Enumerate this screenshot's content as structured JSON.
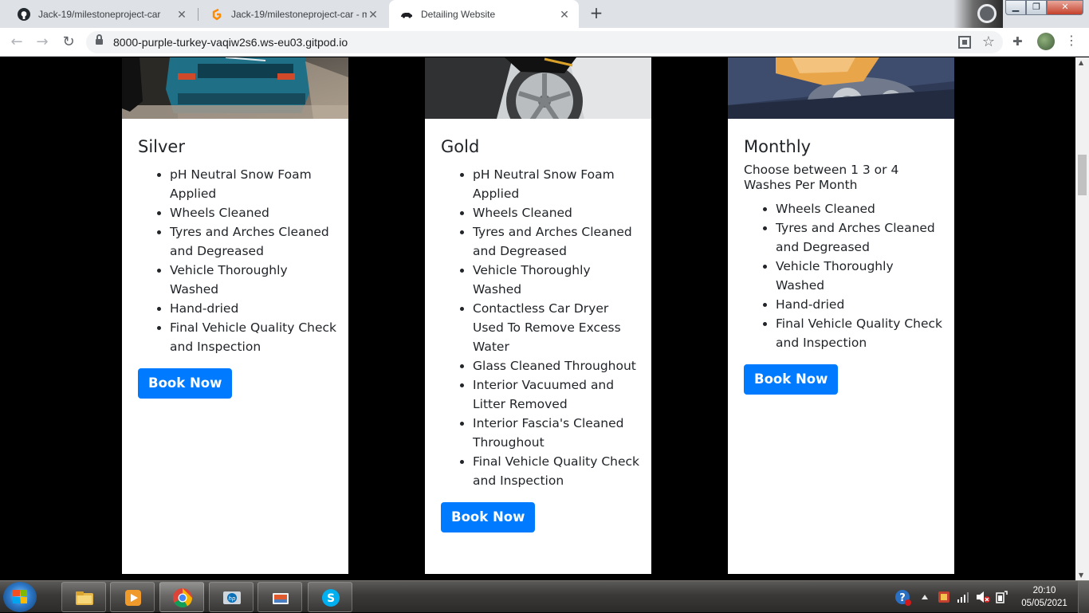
{
  "browser": {
    "tabs": [
      {
        "title": "Jack-19/milestoneproject-car",
        "icon": "github-icon",
        "active": false
      },
      {
        "title": "Jack-19/milestoneproject-car - m",
        "icon": "gitpod-icon",
        "active": false
      },
      {
        "title": "Detailing Website",
        "icon": "car-icon",
        "active": true
      }
    ],
    "url": "8000-purple-turkey-vaqiw2s6.ws-eu03.gitpod.io"
  },
  "packages": [
    {
      "name": "Silver",
      "features": [
        "pH Neutral Snow Foam Applied",
        "Wheels Cleaned",
        "Tyres and Arches Cleaned and Degreased",
        "Vehicle Thoroughly Washed",
        "Hand-dried",
        "Final Vehicle Quality Check and Inspection"
      ],
      "button": "Book Now"
    },
    {
      "name": "Gold",
      "features": [
        "pH Neutral Snow Foam Applied",
        "Wheels Cleaned",
        "Tyres and Arches Cleaned and Degreased",
        "Vehicle Thoroughly Washed",
        "Contactless Car Dryer Used To Remove Excess Water",
        "Glass Cleaned Throughout",
        "Interior Vacuumed and Litter Removed",
        "Interior Fascia's Cleaned Throughout",
        "Final Vehicle Quality Check and Inspection"
      ],
      "button": "Book Now"
    },
    {
      "name": "Monthly",
      "subtitle": "Choose between 1 3 or 4 Washes Per Month",
      "features": [
        "Wheels Cleaned",
        "Tyres and Arches Cleaned and Degreased",
        "Vehicle Thoroughly Washed",
        "Hand-dried",
        "Final Vehicle Quality Check and Inspection"
      ],
      "button": "Book Now"
    }
  ],
  "taskbar": {
    "apps": [
      "file-explorer-icon",
      "media-player-icon",
      "chrome-icon",
      "hp-icon",
      "paint-icon",
      "skype-icon"
    ],
    "time": "20:10",
    "date": "05/05/2021"
  },
  "colors": {
    "accent": "#007bff",
    "page_bg": "#000000",
    "card_bg": "#ffffff"
  }
}
